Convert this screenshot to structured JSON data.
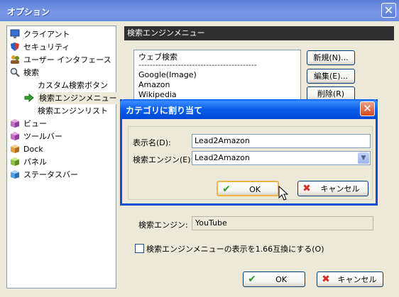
{
  "window": {
    "title": "オプション",
    "close_glyph": "✕"
  },
  "tree": {
    "items": [
      {
        "label": "クライアント",
        "icon": "monitor-icon"
      },
      {
        "label": "セキュリティ",
        "icon": "shield-icon"
      },
      {
        "label": "ユーザー インタフェース",
        "icon": "users-icon"
      },
      {
        "label": "検索",
        "icon": "magnifier-icon"
      },
      {
        "label": "カスタム検索ボタン",
        "icon": ""
      },
      {
        "label": "検索エンジンメニュー",
        "icon": "arrow-right-icon",
        "selected": true
      },
      {
        "label": "検索エンジンリスト",
        "icon": ""
      },
      {
        "label": "ビュー",
        "icon": "box-icon"
      },
      {
        "label": "ツールバー",
        "icon": "box-icon"
      },
      {
        "label": "Dock",
        "icon": "box-icon"
      },
      {
        "label": "パネル",
        "icon": "box-icon"
      },
      {
        "label": "ステータスバー",
        "icon": "box-icon"
      }
    ]
  },
  "main": {
    "heading": "検索エンジンメニュー",
    "list_items": [
      "ウェブ検索",
      "------------------------------------------",
      "Google(Image)",
      "Amazon",
      "Wikipedia"
    ],
    "buttons": {
      "new": "新規(N)...",
      "edit": "編集(E)...",
      "delete": "削除(R)"
    },
    "engine_label": "検索エンジン:",
    "engine_value": "YouTube",
    "compat_checkbox": "検索エンジンメニューの表示を1.66互換にする(O)",
    "ok": "OK",
    "cancel": "キャンセル"
  },
  "dialog": {
    "title": "カテゴリに割り当て",
    "close_glyph": "✕",
    "display_name_label": "表示名(D):",
    "display_name_value": "Lead2Amazon",
    "engine_label": "検索エンジン(E):",
    "engine_value": "Lead2Amazon",
    "ok": "OK",
    "cancel": "キャンセル"
  },
  "colors": {
    "titlebar": "#6E8FE0",
    "dialog_title": "#0A5FE8",
    "ok_check": "#2E9A2E",
    "cancel_x": "#D0302A"
  }
}
